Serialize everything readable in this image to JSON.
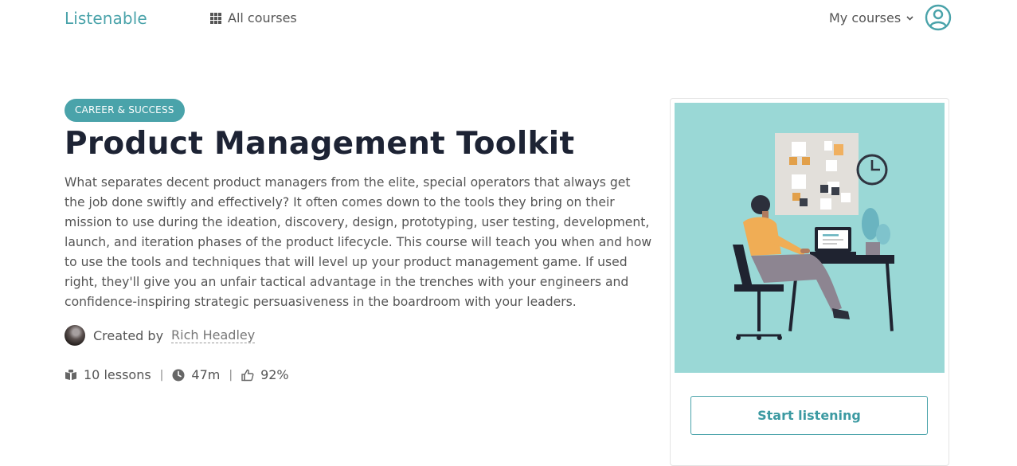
{
  "header": {
    "logo": "Listenable",
    "all_courses_label": "All courses",
    "my_courses_label": "My courses"
  },
  "course": {
    "category": "CAREER & SUCCESS",
    "title": "Product Management Toolkit",
    "description": "What separates decent product managers from the elite, special operators that always get the job done swiftly and effectively? It often comes down to the tools they bring on their mission to use during the ideation, discovery, design, prototyping, user testing, development, launch, and iteration phases of the product lifecycle. This course will teach you when and how to use the tools and techniques that will level up your product management game. If used right, they'll give you an unfair tactical advantage in the trenches with your engineers and confidence-inspiring strategic persuasiveness in the boardroom with your leaders.",
    "created_by_label": "Created by",
    "author": "Rich Headley",
    "stats": {
      "lessons": "10 lessons",
      "duration": "47m",
      "rating": "92%",
      "separator": "|"
    }
  },
  "card": {
    "cta_label": "Start listening"
  },
  "colors": {
    "accent": "#4aa3aa",
    "title": "#1d2334",
    "image_bg": "#9ad8d6"
  },
  "icons": [
    "grid-icon",
    "chevron-down-icon",
    "user-circle-icon",
    "book-icon",
    "clock-icon",
    "thumbs-up-icon"
  ]
}
